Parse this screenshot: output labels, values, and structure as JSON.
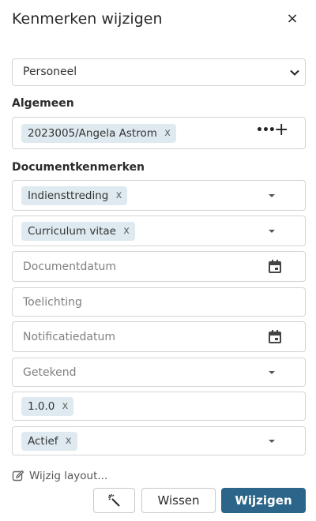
{
  "dialog": {
    "title": "Kenmerken wijzigen",
    "close_label": "×"
  },
  "category_select": {
    "value": "Personeel"
  },
  "general": {
    "heading": "Algemeen",
    "chip": "2023005/Angela Astrom",
    "more_label": "•••",
    "add_label": "+"
  },
  "document": {
    "heading": "Documentkenmerken",
    "type_chip": "Indiensttreding",
    "subtype_chip": "Curriculum vitae",
    "date_placeholder": "Documentdatum",
    "note_placeholder": "Toelichting",
    "notify_placeholder": "Notificatiedatum",
    "signed_placeholder": "Getekend",
    "version_chip": "1.0.0",
    "status_chip": "Actief"
  },
  "chip_remove_label": "x",
  "footer": {
    "layout_link": "Wijzig layout...",
    "clear_button": "Wissen",
    "apply_button": "Wijzigen"
  },
  "colors": {
    "primary": "#2b6589",
    "chip_bg": "#deeaf0",
    "border": "#d4d4d4"
  }
}
